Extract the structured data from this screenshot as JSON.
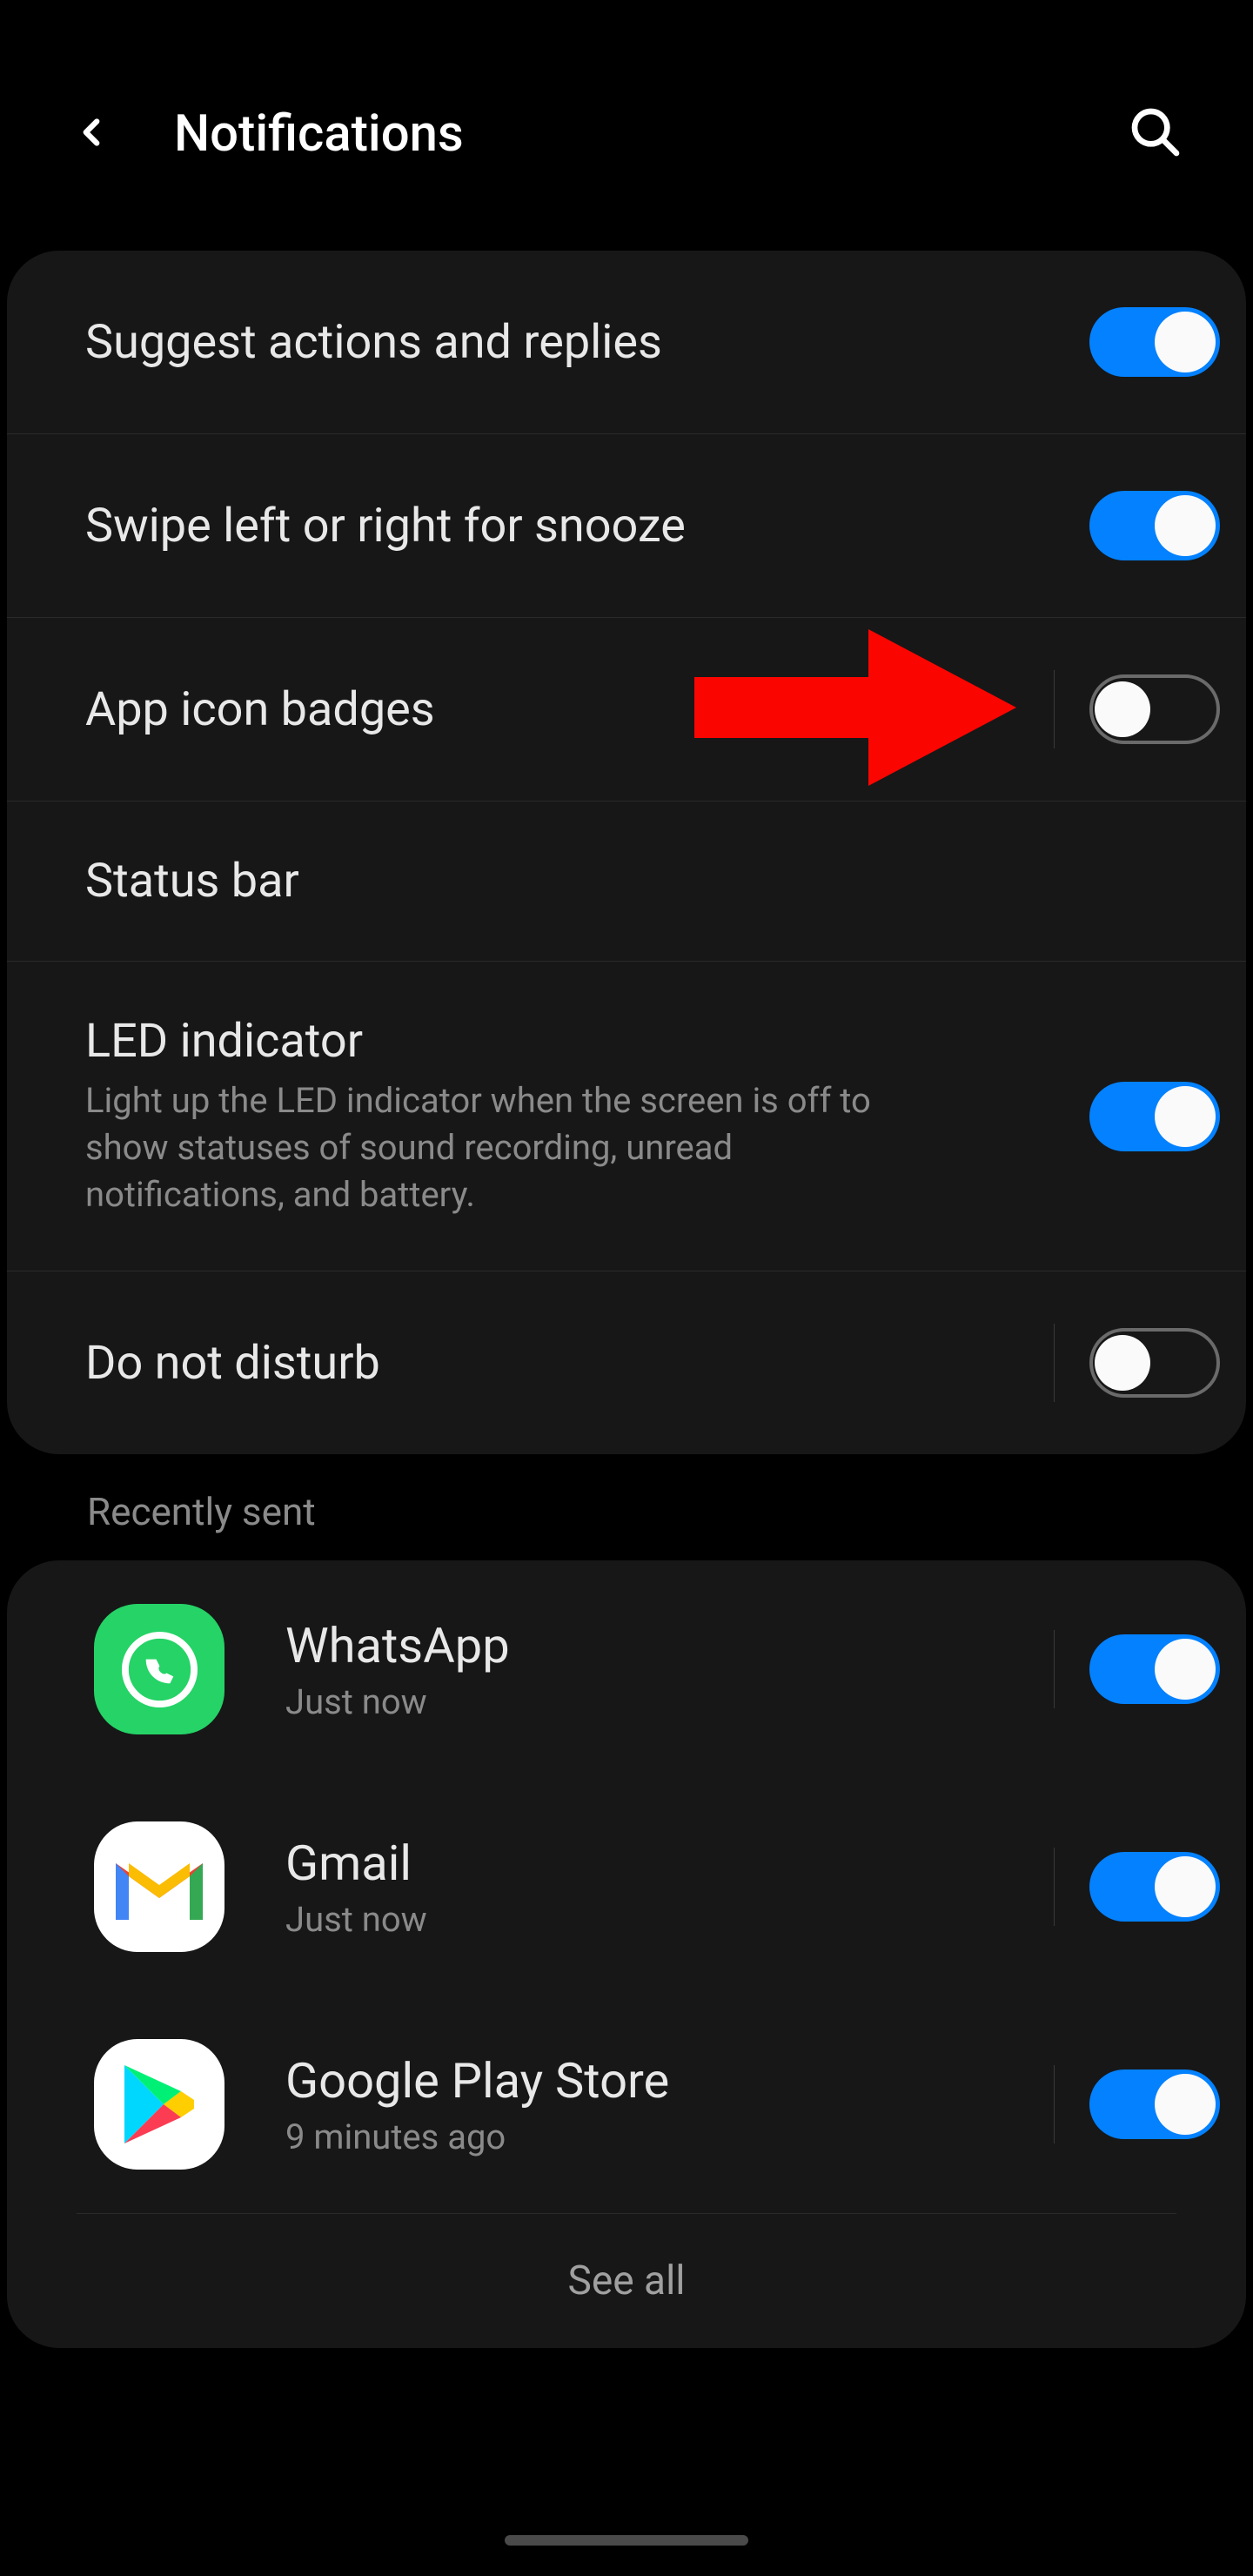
{
  "header": {
    "title": "Notifications"
  },
  "settings": [
    {
      "title": "Suggest actions and replies",
      "toggle": true
    },
    {
      "title": "Swipe left or right for snooze",
      "toggle": true
    },
    {
      "title": "App icon badges",
      "toggle": false,
      "pointer": true,
      "border": true
    },
    {
      "title": "Status bar",
      "toggle": null
    },
    {
      "title": "LED indicator",
      "subtitle": "Light up the LED indicator when the screen is off to show statuses of sound recording, unread notifications, and battery.",
      "toggle": true
    },
    {
      "title": "Do not disturb",
      "toggle": false,
      "border": true
    }
  ],
  "recently_sent_label": "Recently sent",
  "apps": [
    {
      "name": "WhatsApp",
      "time": "Just now",
      "icon": "whatsapp",
      "toggle": true
    },
    {
      "name": "Gmail",
      "time": "Just now",
      "icon": "gmail",
      "toggle": true
    },
    {
      "name": "Google Play Store",
      "time": "9 minutes ago",
      "icon": "play",
      "toggle": true
    }
  ],
  "see_all": "See all"
}
